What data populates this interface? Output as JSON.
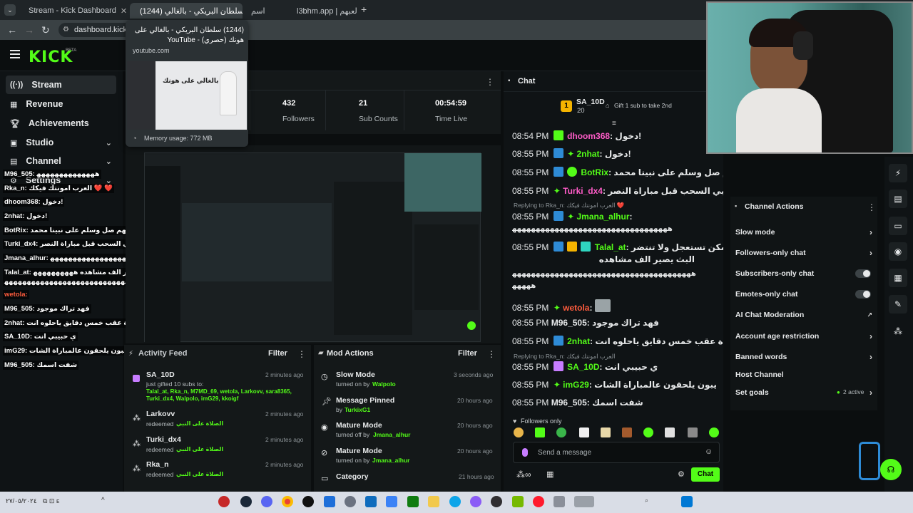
{
  "browser": {
    "tabs": [
      {
        "title": "Stream - Kick Dashboard",
        "active": false
      },
      {
        "title": "(1244) سلطان البريكي - بالغالي",
        "active": true
      },
      {
        "title": "اسم",
        "active": false
      },
      {
        "title": "l3bhm.app | لعبهم",
        "active": false
      }
    ],
    "url": "dashboard.kick.co",
    "tooltip": {
      "title": "(1244) سلطان البريكي - بالغالي على هونك (حصري) - YouTube",
      "domain": "youtube.com",
      "memory": "Memory usage: 772 MB",
      "thumb_text": "بالغالي على هونك"
    }
  },
  "kick": {
    "logo": "KICK",
    "beta": "BETA"
  },
  "sidebar": {
    "items": [
      {
        "label": "Stream",
        "icon": "stream-icon",
        "active": true
      },
      {
        "label": "Revenue",
        "icon": "revenue-icon"
      },
      {
        "label": "Achievements",
        "icon": "trophy-icon"
      },
      {
        "label": "Studio",
        "icon": "studio-icon",
        "chevron": true
      },
      {
        "label": "Channel",
        "icon": "channel-icon",
        "chevron": true
      },
      {
        "label": "Settings",
        "icon": "gear-icon",
        "chevron": true
      }
    ]
  },
  "overlay_chat": [
    "M96_505: ﻫﻬﻬﻬﻬﻬﻬﻬﻬﻬﻬﻬﻬﻬ",
    "Rka_n: العرب امونتك فيكك ❤️ ❤️",
    "dhoom368: دخول!",
    "2nhat: دخول!",
    "BotRix: اللهم صل وسلم على نبينا محمد",
    "Turki_dx4: يلا نبي السحب قبل مباراة النصر",
    "Jmana_alhur: ﻫﻬﻬﻬﻬﻬﻬﻬﻬﻬﻬﻬﻬﻬﻬﻬﻬﻬﻬﻬﻬﻬﻬﻬﻬﻬﻬﻬﻬﻬﻬﻬﻬﻬﻬ",
    "Talal_at: بدر ممكن تستعجل ولا تنتضر البث يصير الف مشاهده ﻫﻬﻬﻬﻬﻬﻬﻬﻬﻬ",
    "ﻫﻬﻬﻬﻬﻬﻬﻬﻬﻬﻬﻬﻬﻬﻬﻬﻬﻬﻬﻬﻬﻬﻬﻬﻬﻬﻬﻬﻬﻬﻬﻬﻬﻬﻬﻬﻬﻬﻬﻬ",
    "wetola:",
    "M96_505: فهد تراك موجود",
    "2nhat: المباراة عقب خمس دقايق ياحلوه انت",
    "SA_10D: ي حبيبي انت",
    "imG29: يبون يلحقون عالمباراة الشات",
    "M96_505: شفت اسمك"
  ],
  "stats": [
    {
      "value": "432",
      "label": "Followers"
    },
    {
      "value": "21",
      "label": "Sub Counts"
    },
    {
      "value": "00:54:59",
      "label": "Time Live"
    }
  ],
  "activity_feed": {
    "title": "Activity Feed",
    "filter": "Filter",
    "items": [
      {
        "name": "SA_10D",
        "time": "2 minutes ago",
        "line1": "just gifted 10 subs to:",
        "line2": "Talal_at, Rka_n, M7MD_69, wetola, Larkovv, sara8365,",
        "line3": "Turki_dx4, Walpolo, imG29, kkoigf"
      },
      {
        "name": "Larkovv",
        "time": "2 minutes ago",
        "line1": "redeemed",
        "reward": "الصلاة على النبي"
      },
      {
        "name": "Turki_dx4",
        "time": "2 minutes ago",
        "line1": "redeemed",
        "reward": "الصلاة على النبي"
      },
      {
        "name": "Rka_n",
        "time": "2 minutes ago",
        "line1": "redeemed",
        "reward": "الصلاة على النبي"
      }
    ]
  },
  "mod_actions": {
    "title": "Mod Actions",
    "filter": "Filter",
    "items": [
      {
        "name": "Slow Mode",
        "time": "3 seconds ago",
        "sub": "turned on by",
        "by": "Walpolo"
      },
      {
        "name": "Message Pinned",
        "time": "20 hours ago",
        "sub": "by",
        "by": "TurkixG1"
      },
      {
        "name": "Mature Mode",
        "time": "20 hours ago",
        "sub": "turned off by",
        "by": "Jmana_alhur"
      },
      {
        "name": "Mature Mode",
        "time": "20 hours ago",
        "sub": "turned on by",
        "by": "Jmana_alhur"
      },
      {
        "name": "Category",
        "time": "21 hours ago",
        "sub": "",
        "by": ""
      }
    ]
  },
  "chat": {
    "title": "Chat",
    "pinned": {
      "rank": "1",
      "user": "SA_10D",
      "count": "20",
      "gift": "Gift 1 sub to take 2nd"
    },
    "messages": [
      {
        "time": "08:54 PM",
        "user": "dhoom368",
        "color": "#ff5cc8",
        "text": "دخول!"
      },
      {
        "time": "08:55 PM",
        "user": "2nhat",
        "color": "#53fc18",
        "text": "دخول!"
      },
      {
        "time": "08:55 PM",
        "user": "BotRix",
        "color": "#53fc18",
        "text": "اللهم صل وسلم على نبينا محمد"
      },
      {
        "time": "08:55 PM",
        "user": "Turki_dx4",
        "color": "#ff5cc8",
        "text": "يلا نبي السحب قبل مباراة النصر"
      },
      {
        "reply": "Replying to Rka_n: العرب امونتك فيكك ❤️"
      },
      {
        "time": "08:55 PM",
        "user": "Jmana_alhur",
        "color": "#53fc18",
        "text": ""
      },
      {
        "cont": "ﻫﻬﻬﻬﻬﻬﻬﻬﻬﻬﻬﻬﻬﻬﻬﻬﻬﻬﻬﻬﻬﻬﻬﻬﻬﻬﻬﻬﻬﻬﻬﻬﻬﻬ"
      },
      {
        "time": "08:55 PM",
        "user": "Talal_at",
        "color": "#53fc18",
        "text": "بدر ممكن تستعجل ولا تنتضر"
      },
      {
        "cont": "البث يصير الف مشاهده"
      },
      {
        "cont": "ﻫﻬﻬﻬﻬﻬﻬﻬﻬﻬﻬﻬﻬﻬﻬﻬﻬﻬﻬﻬﻬﻬﻬﻬﻬﻬﻬﻬﻬﻬﻬﻬﻬﻬﻬﻬﻬﻬﻬ"
      },
      {
        "cont": "ﻫﻬﻬﻬﻬ"
      },
      {
        "time": "08:55 PM",
        "user": "wetola",
        "color": "#ff5c3d",
        "text": ""
      },
      {
        "time": "08:55 PM",
        "user": "M96_505",
        "color": "#e7e9ea",
        "text": "فهد تراك موجود"
      },
      {
        "time": "08:55 PM",
        "user": "2nhat",
        "color": "#53fc18",
        "text": "المباراة عقب خمس دقايق ياحلوه انت"
      },
      {
        "reply": "Replying to Rka_n: العرب امونتك فيكك"
      },
      {
        "time": "08:55 PM",
        "user": "SA_10D",
        "color": "#53fc18",
        "text": "ي حبيبي انت"
      },
      {
        "time": "08:55 PM",
        "user": "imG29",
        "color": "#53fc18",
        "text": "يبون يلحقون عالمباراة الشات"
      },
      {
        "time": "08:55 PM",
        "user": "M96_505",
        "color": "#e7e9ea",
        "text": "شفت اسمك"
      }
    ],
    "followers_only": "Followers only",
    "placeholder": "Send a message",
    "send": "Chat"
  },
  "channel_actions": {
    "title": "Channel Actions",
    "items": [
      {
        "label": "Slow mode",
        "type": "chevron"
      },
      {
        "label": "Followers-only chat",
        "type": "chevron"
      },
      {
        "label": "Subscribers-only chat",
        "type": "toggle"
      },
      {
        "label": "Emotes-only chat",
        "type": "toggle"
      },
      {
        "label": "AI Chat Moderation",
        "type": "external"
      },
      {
        "label": "Account age restriction",
        "type": "chevron"
      },
      {
        "label": "Banned words",
        "type": "chevron"
      },
      {
        "label": "Host Channel",
        "type": "none"
      },
      {
        "label": "Set goals",
        "type": "chevron",
        "extra": "2 active"
      }
    ]
  },
  "taskbar": {
    "date": "٢٧/٠٥/٢٠٢٤"
  },
  "colors": {
    "accent": "#53fc18",
    "bg": "#0b0e0f",
    "panel": "#141819"
  }
}
